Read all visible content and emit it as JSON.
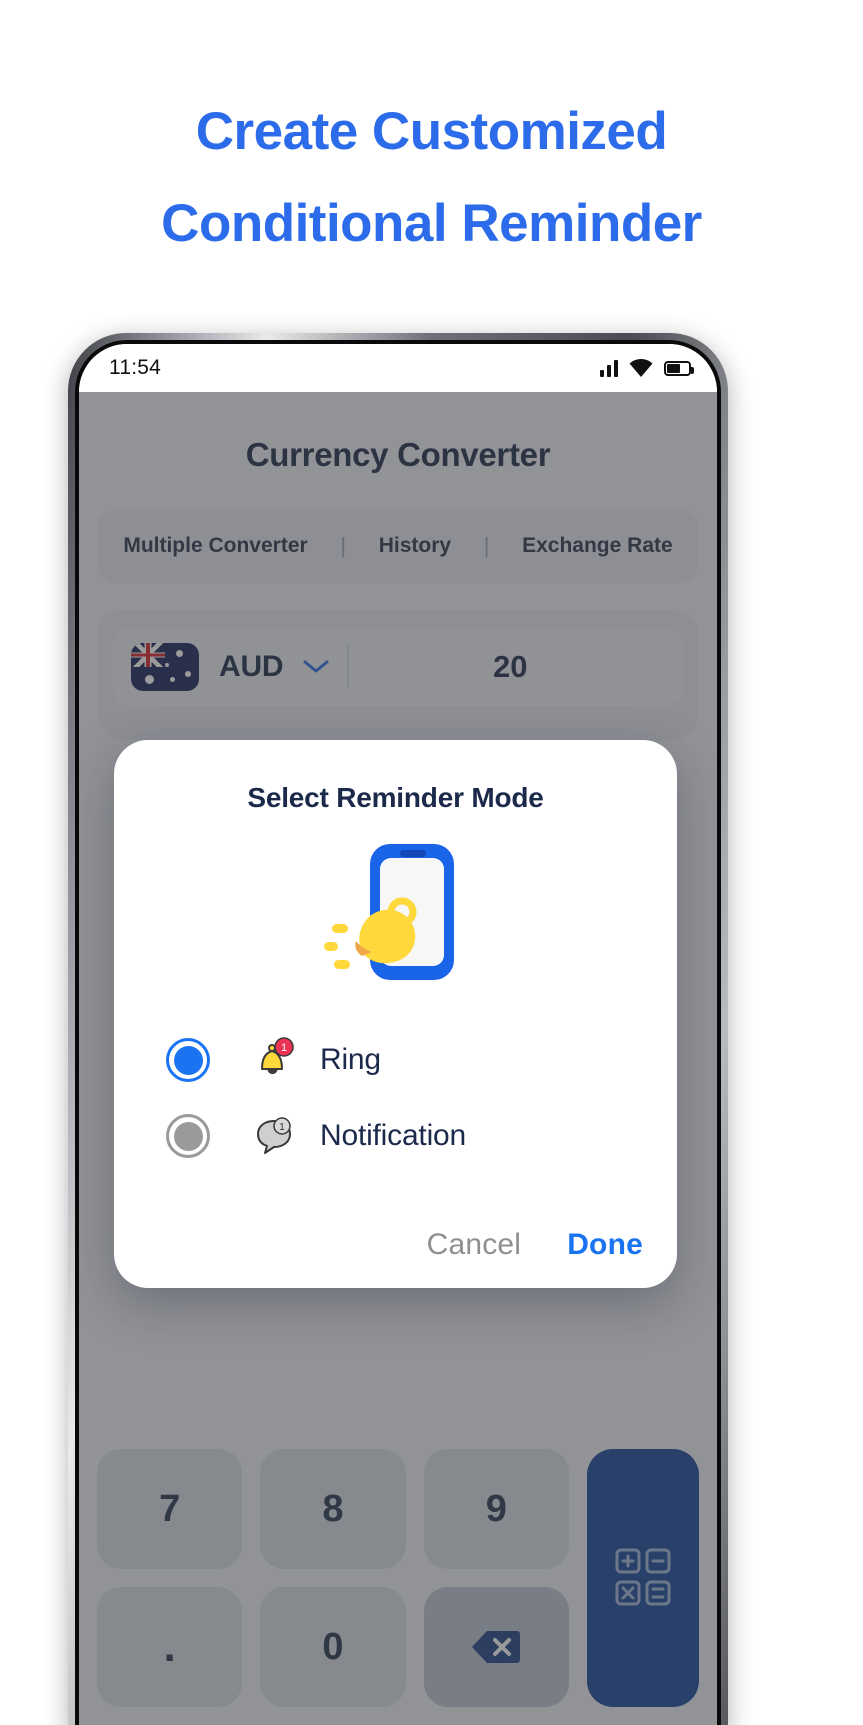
{
  "headline": {
    "line1": "Create Customized",
    "line2": "Conditional Reminder",
    "color": "#2c6ceb"
  },
  "phone": {
    "status_bar": {
      "time": "11:54",
      "icons": [
        "signal-icon",
        "wifi-icon",
        "battery-icon"
      ]
    },
    "app": {
      "title": "Currency Converter",
      "tabs": [
        {
          "label": "Multiple Converter"
        },
        {
          "label": "History"
        },
        {
          "label": "Exchange Rate"
        }
      ],
      "tab_separator": "|",
      "converter_row": {
        "flag": "australia-flag-icon",
        "currency_code": "AUD",
        "dropdown_icon": "chevron-down-icon",
        "amount": "20"
      },
      "swap_button_icon": "swap-arrows-icon",
      "keypad": {
        "row1": [
          "7",
          "8",
          "9"
        ],
        "row2": [
          ".",
          "0",
          "backspace-icon"
        ],
        "calculator_icon": "calculator-icon"
      }
    }
  },
  "modal": {
    "title": "Select Reminder Mode",
    "illustration": "phone-with-bell-illustration",
    "options": [
      {
        "id": "ring",
        "label": "Ring",
        "icon": "bell-badge-icon",
        "selected": true
      },
      {
        "id": "notification",
        "label": "Notification",
        "icon": "chat-bubble-badge-icon",
        "selected": false
      }
    ],
    "cancel_label": "Cancel",
    "done_label": "Done",
    "accent_color": "#1a73f0",
    "muted_color": "#8e8e93"
  }
}
